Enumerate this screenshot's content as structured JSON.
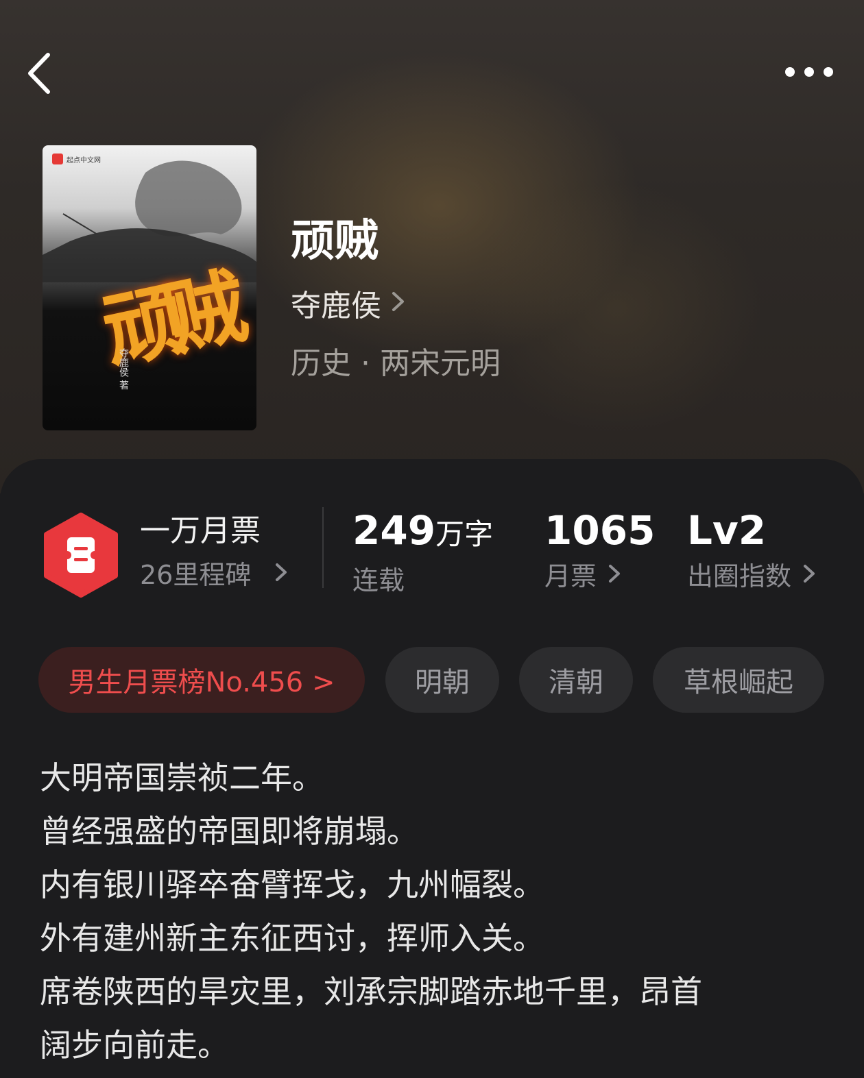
{
  "book": {
    "title": "顽贼",
    "author": "夺鹿侯",
    "genre": "历史 · 两宋元明",
    "cover": {
      "publisher": "起点中文网",
      "title_art": "顽贼",
      "author_vertical": "夺鹿侯 著"
    }
  },
  "stats": {
    "milestone_title": "一万月票",
    "milestone_sub": "26里程碑",
    "words_value": "249",
    "words_unit": "万字",
    "words_label": "连载",
    "tickets_value": "1065",
    "tickets_label": "月票",
    "level_value": "Lv2",
    "level_label": "出圈指数"
  },
  "tags": [
    "男生月票榜No.456 >",
    "明朝",
    "清朝",
    "草根崛起"
  ],
  "description": [
    "大明帝国崇祯二年。",
    "曾经强盛的帝国即将崩塌。",
    "内有银川驿卒奋臂挥戈，九州幅裂。",
    "外有建州新主东征西讨，挥师入关。",
    "席卷陕西的旱灾里，刘承宗脚踏赤地千里，昂首",
    "阔步向前走。"
  ],
  "colors": {
    "background": "#1c1c1e",
    "accent_red": "#ef4d4d",
    "badge_red": "#e8383d"
  },
  "icons": {
    "back": "chevron-left-icon",
    "more": "more-dots-icon",
    "badge": "ticket-hexagon-icon"
  }
}
